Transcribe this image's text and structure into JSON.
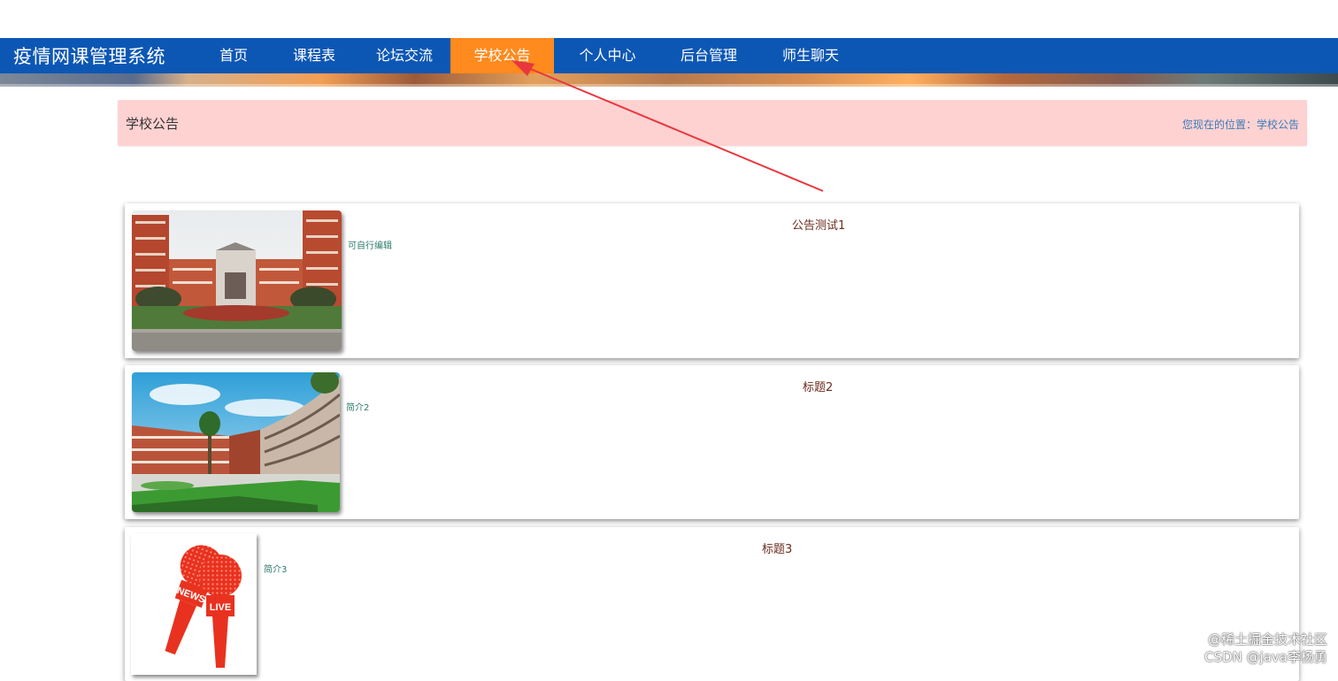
{
  "nav": {
    "brand": "疫情网课管理系统",
    "items": [
      "首页",
      "课程表",
      "论坛交流",
      "学校公告",
      "个人中心",
      "后台管理",
      "师生聊天"
    ],
    "active_index": 3
  },
  "breadcrumb": {
    "title": "学校公告",
    "location_label": "您现在的位置：",
    "location_value": "学校公告"
  },
  "announcements": [
    {
      "title": "公告测试1",
      "summary": "可自行编辑"
    },
    {
      "title": "标题2",
      "summary": "简介2"
    },
    {
      "title": "标题3",
      "summary": "简介3"
    }
  ],
  "thumbnail_text": {
    "news": "NEWS",
    "live": "LIVE"
  },
  "watermark": {
    "line1": "@稀土掘金技术社区",
    "line2": "CSDN @java李杨勇"
  },
  "colors": {
    "nav_bg": "#0d57b4",
    "nav_active": "#ff8a1e",
    "breadcrumb_bg": "#ffd2d2",
    "link_blue": "#3a7bb7",
    "annotation_arrow": "#e8373d"
  }
}
